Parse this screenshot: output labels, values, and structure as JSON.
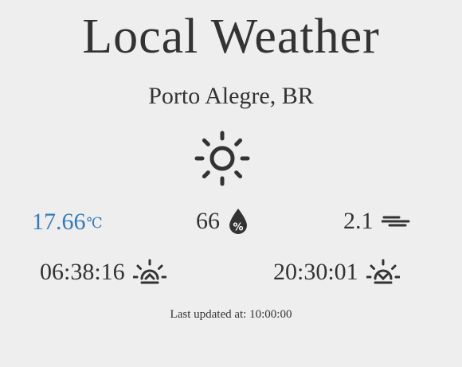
{
  "header": {
    "title": "Local Weather",
    "location": "Porto Alegre, BR"
  },
  "current": {
    "condition_icon": "sun-icon",
    "temperature": "17.66",
    "temperature_unit": "℃",
    "humidity": "66",
    "humidity_icon": "humidity-percent-icon",
    "wind_speed": "2.1",
    "wind_icon": "wind-icon"
  },
  "sun": {
    "sunrise": "06:38:16",
    "sunrise_icon": "sunrise-icon",
    "sunset": "20:30:01",
    "sunset_icon": "sunset-icon"
  },
  "footer": {
    "last_updated_label": "Last updated at:",
    "last_updated_time": "10:00:00"
  },
  "colors": {
    "background": "#eeeeee",
    "text": "#333333",
    "temperature": "#337ab7"
  }
}
